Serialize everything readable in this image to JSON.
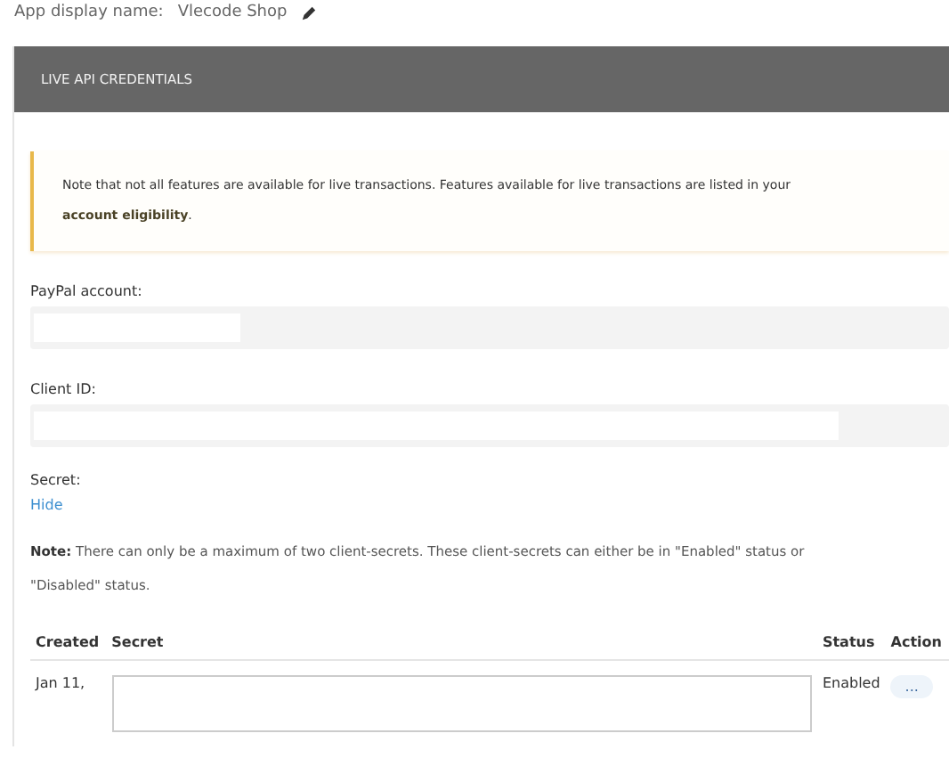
{
  "app_name": {
    "label": "App display name:",
    "value": "Vlecode Shop"
  },
  "section_title": "LIVE API CREDENTIALS",
  "notice": {
    "text": "Note that not all features are available for live transactions. Features available for live transactions are listed in your ",
    "link": "account eligibility",
    "after": "."
  },
  "fields": [
    {
      "label": "PayPal account:",
      "kind": "short"
    },
    {
      "label": "Client ID:",
      "kind": "long"
    }
  ],
  "secret": {
    "label": "Secret:",
    "toggle": "Hide"
  },
  "note": "**Note:** There can only be a maximum of two client-secrets. These client-secrets can either be in \"Enabled\" status or \"Disabled\" status.",
  "table": {
    "columns": [
      "Created",
      "Secret",
      "Status",
      "Action"
    ],
    "rows": [
      {
        "created": "Jan 11,",
        "status": "Enabled",
        "action": "..."
      }
    ]
  }
}
